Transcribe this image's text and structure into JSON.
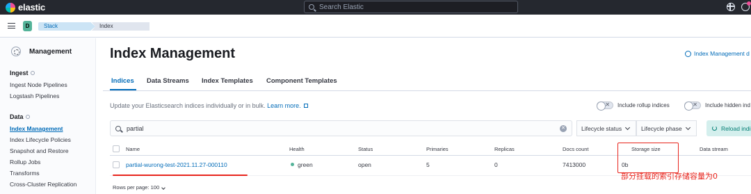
{
  "header": {
    "brand": "elastic",
    "search_placeholder": "Search Elastic",
    "help_icon": "help-icon",
    "news_icon": "newsfeed-icon"
  },
  "breadcrumbs": {
    "space_initial": "D",
    "items": [
      "Stack Management",
      "Index Management"
    ]
  },
  "sidebar": {
    "title": "Management",
    "sections": [
      {
        "label": "Ingest",
        "items": [
          "Ingest Node Pipelines",
          "Logstash Pipelines"
        ]
      },
      {
        "label": "Data",
        "items": [
          "Index Management",
          "Index Lifecycle Policies",
          "Snapshot and Restore",
          "Rollup Jobs",
          "Transforms",
          "Cross-Cluster Replication"
        ]
      }
    ],
    "active_item": "Index Management"
  },
  "main": {
    "title": "Index Management",
    "doc_link": "Index Management d",
    "tabs": [
      "Indices",
      "Data Streams",
      "Index Templates",
      "Component Templates"
    ],
    "active_tab": "Indices",
    "description": "Update your Elasticsearch indices individually or in bulk.",
    "description_link": "Learn more.",
    "toggles": [
      "Include rollup indices",
      "Include hidden ind"
    ],
    "filter_value": "partial",
    "dropdowns": [
      "Lifecycle status",
      "Lifecycle phase"
    ],
    "reload_label": "Reload indi"
  },
  "table": {
    "headers": [
      "Name",
      "Health",
      "Status",
      "Primaries",
      "Replicas",
      "Docs count",
      "Storage size",
      "Data stream"
    ],
    "rows": [
      {
        "name": "partial-wurong-test-2021.11.27-000110",
        "health": "green",
        "status": "open",
        "primaries": "5",
        "replicas": "0",
        "docs_count": "7413000",
        "storage_size": "0b",
        "data_stream": ""
      }
    ],
    "rows_per_page": "Rows per page: 100"
  },
  "annotation": {
    "note": "部分挂载的索引存储容量为0",
    "color": "#e8241c"
  },
  "colors": {
    "header_bg": "#25282f",
    "link": "#006bb8",
    "health_green": "#54b399"
  }
}
